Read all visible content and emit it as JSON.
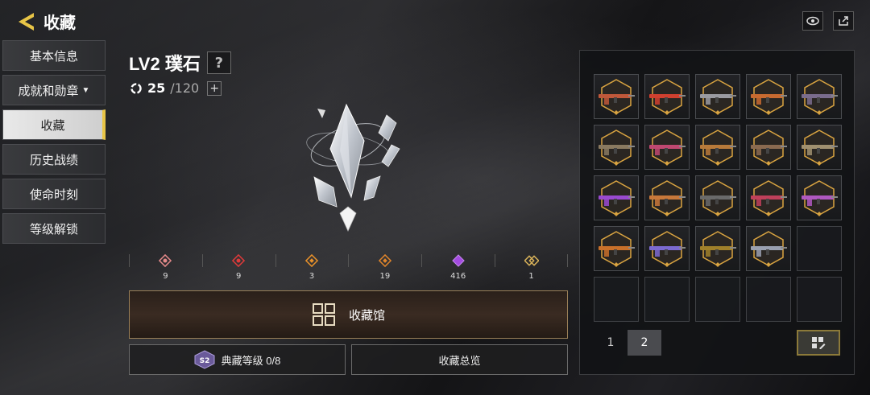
{
  "header": {
    "title": "收藏"
  },
  "sidebar": {
    "items": [
      {
        "label": "基本信息",
        "active": false
      },
      {
        "label": "成就和勋章",
        "active": false,
        "dropdown": true
      },
      {
        "label": "收藏",
        "active": true
      },
      {
        "label": "历史战绩",
        "active": false
      },
      {
        "label": "使命时刻",
        "active": false
      },
      {
        "label": "等级解锁",
        "active": false
      }
    ]
  },
  "level": {
    "title": "LV2 璞石",
    "progress_current": "25",
    "progress_max": "/120"
  },
  "stats": [
    {
      "icon": "rose-diamond-icon",
      "color": "#e58a8a",
      "value": "9"
    },
    {
      "icon": "red-diamond-icon",
      "color": "#e03a3a",
      "value": "9"
    },
    {
      "icon": "orange-diamond-icon",
      "color": "#e8912a",
      "value": "3"
    },
    {
      "icon": "orange-diamond-icon",
      "color": "#e0852b",
      "value": "19"
    },
    {
      "icon": "purple-diamond-icon",
      "color": "#a34be0",
      "value": "416"
    },
    {
      "icon": "gold-chain-icon",
      "color": "#d8b25a",
      "value": "1"
    }
  ],
  "buttons": {
    "hall": "收藏馆",
    "rank": "典藏等级 0/8",
    "rank_badge": "S2",
    "overview": "收藏总览"
  },
  "grid": {
    "items": [
      {
        "color": "#c0583a"
      },
      {
        "color": "#d0402f"
      },
      {
        "color": "#9a9aa0"
      },
      {
        "color": "#c86a30"
      },
      {
        "color": "#7a6c8c"
      },
      {
        "color": "#8a7a60"
      },
      {
        "color": "#c04870"
      },
      {
        "color": "#b87a3a"
      },
      {
        "color": "#8a6a50"
      },
      {
        "color": "#a09070"
      },
      {
        "color": "#9a4ad0"
      },
      {
        "color": "#c8783a"
      },
      {
        "color": "#6a6a6a"
      },
      {
        "color": "#c0405a"
      },
      {
        "color": "#b058c0"
      },
      {
        "color": "#c8702a"
      },
      {
        "color": "#7c6ad0"
      },
      {
        "color": "#a0802a"
      },
      {
        "color": "#9aa0b0"
      }
    ],
    "empty_count": 6
  },
  "pager": {
    "pages": [
      "1",
      "2"
    ],
    "current": "2"
  },
  "colors": {
    "accent": "#e8c547",
    "hex_border": "#d9a441"
  }
}
